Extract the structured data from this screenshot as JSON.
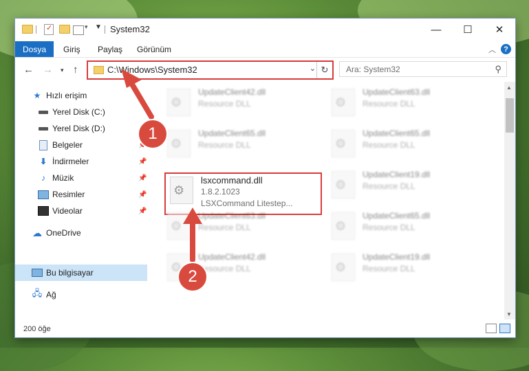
{
  "window": {
    "title": "System32"
  },
  "ribbon": {
    "file_tab": "Dosya",
    "tabs": [
      "Giriş",
      "Paylaş",
      "Görünüm"
    ],
    "help": "?"
  },
  "nav": {
    "address": "C:\\Windows\\System32",
    "search_placeholder": "Ara: System32"
  },
  "sidebar": {
    "items": [
      {
        "label": "Hızlı erişim",
        "icon": "star-icon"
      },
      {
        "label": "Yerel Disk (C:)",
        "icon": "drive-icon",
        "pinned": true
      },
      {
        "label": "Yerel Disk (D:)",
        "icon": "drive-icon",
        "pinned": true
      },
      {
        "label": "Belgeler",
        "icon": "documents-icon",
        "pinned": true
      },
      {
        "label": "İndirmeler",
        "icon": "download-icon",
        "pinned": true
      },
      {
        "label": "Müzik",
        "icon": "music-icon",
        "pinned": true
      },
      {
        "label": "Resimler",
        "icon": "pictures-icon",
        "pinned": true
      },
      {
        "label": "Videolar",
        "icon": "videos-icon",
        "pinned": true
      },
      {
        "label": "OneDrive",
        "icon": "cloud-icon"
      },
      {
        "label": "Bu bilgisayar",
        "icon": "computer-icon",
        "active": true
      },
      {
        "label": "Ağ",
        "icon": "network-icon"
      }
    ]
  },
  "files": [
    {
      "name": "UpdateClient42.dll",
      "type": "Resource DLL",
      "blurred": true
    },
    {
      "name": "UpdateClient63.dll",
      "type": "Resource DLL",
      "blurred": true
    },
    {
      "name": "UpdateClient65.dll",
      "type": "Resource DLL",
      "blurred": true
    },
    {
      "name": "UpdateClient65.dll",
      "type": "Resource DLL",
      "blurred": true
    },
    {
      "name": "lsxcommand.dll",
      "version": "1.8.2.1023",
      "description": "LSXCommand Litestep...",
      "blurred": false
    },
    {
      "name": "UpdateClient19.dll",
      "type": "Resource DLL",
      "blurred": true
    },
    {
      "name": "UpdateClient63.dll",
      "type": "Resource DLL",
      "blurred": true
    },
    {
      "name": "UpdateClient65.dll",
      "type": "Resource DLL",
      "blurred": true
    },
    {
      "name": "UpdateClient42.dll",
      "type": "Resource DLL",
      "blurred": true
    },
    {
      "name": "UpdateClient19.dll",
      "type": "Resource DLL",
      "blurred": true
    }
  ],
  "status": {
    "count_text": "200 öğe"
  },
  "callouts": [
    "1",
    "2"
  ],
  "colors": {
    "accent": "#1a6fc4",
    "highlight": "#d93a3a",
    "selected": "#cce4f7"
  }
}
